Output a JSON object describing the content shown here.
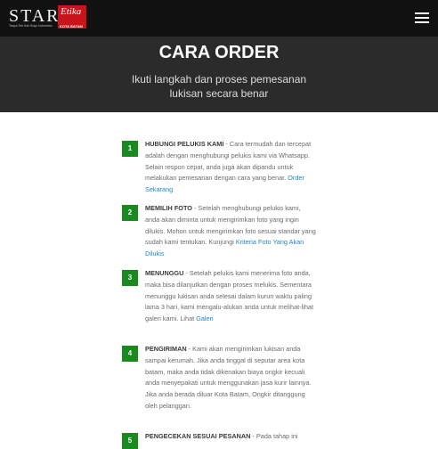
{
  "logo": {
    "brand_left": "START",
    "brand_box": "Etika",
    "tagline": "Tanpa Teh Kah Boyo Indonesia",
    "city": "KOTA BATAM"
  },
  "nav": {
    "menu_icon": "hamburger-icon"
  },
  "hero": {
    "title": "CARA ORDER",
    "subtitle": "Ikuti langkah dan proses pemesanan lukisan secara benar"
  },
  "steps": [
    {
      "number": "1",
      "heading": "HUBUNGI PELUKIS KAMI",
      "body": " - Cara termudah dan tercepat adalah dengan menghubungi pelukis kami via Whatsapp. Selain respon cepat, anda juga akan dipandu untuk melakukan pemesanan dengan cara yang benar. ",
      "link": "Order Sekarang"
    },
    {
      "number": "2",
      "heading": "MEMILIH FOTO",
      "body": " - Setelah menghubungi pelukis kami, anda akan diminta untuk mengirimkan foto yang ingin dilukis. Mohon untuk mengirimkan foto sesuai standar yang sudah kami tentukan. Kunjungi ",
      "link": "Kriteria Foto Yang Akan Dilukis"
    },
    {
      "number": "3",
      "heading": "MENUNGGU",
      "body": " - Setelah pelukis kami menerima foto anda, maka bisa dilanjutkan dengan proses melukis. Sementara menunggu lukisan anda selesai dalam kurun waktu paling lama 3 hari, kami mengalu-alukan anda untuk melihat-lihat galeri kami. Lihat ",
      "link": "Galeri"
    },
    {
      "number": "4",
      "heading": "PENGIRIMAN",
      "body": " - Kami akan mengirimkan lukisan anda sampai kerumah. Jika anda tinggal di seputar area kota batam, maka anda tidak dikenakan biaya ongkir kecuali anda menyepakati untuk menggunakan jasa kurir lainnya. Jika anda berada diluar Kota Batam, Ongkir ditanggung oleh pelanggan.",
      "link": ""
    },
    {
      "number": "5",
      "heading": "PENGECEKAN SESUAI PESANAN",
      "body": " - Pada tahap ini",
      "link": ""
    }
  ]
}
